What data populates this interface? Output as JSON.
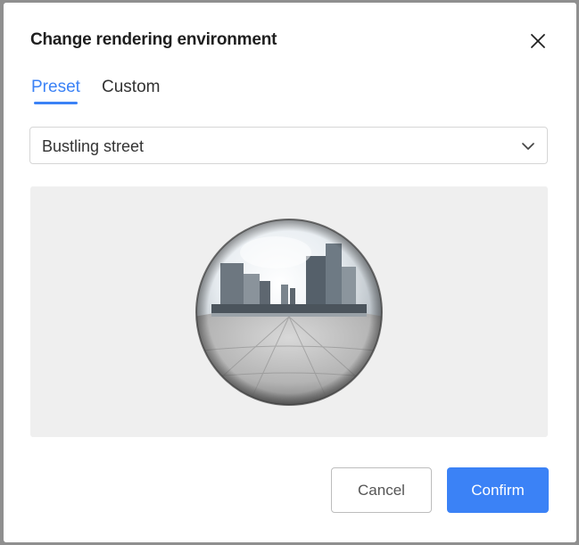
{
  "dialog": {
    "title": "Change rendering environment",
    "close_icon": "close-icon"
  },
  "tabs": [
    {
      "label": "Preset",
      "active": true
    },
    {
      "label": "Custom",
      "active": false
    }
  ],
  "environment_select": {
    "value": "Bustling street",
    "icon": "chevron-down-icon"
  },
  "preview": {
    "image": "chrome-sphere-environment-preview"
  },
  "buttons": {
    "cancel_label": "Cancel",
    "confirm_label": "Confirm"
  },
  "colors": {
    "accent": "#3b82f6",
    "preview_bg": "#efefef",
    "text": "#333333"
  }
}
